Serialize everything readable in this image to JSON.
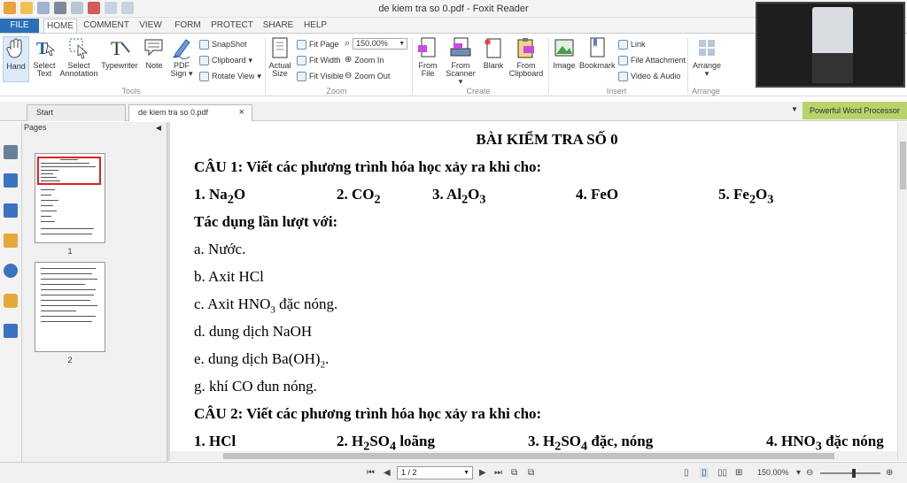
{
  "window": {
    "title": "de kiem tra so 0.pdf - Foxit Reader"
  },
  "menu": {
    "tabs": [
      "FILE",
      "HOME",
      "COMMENT",
      "VIEW",
      "FORM",
      "PROTECT",
      "SHARE",
      "HELP"
    ]
  },
  "ribbon": {
    "tools": {
      "group_label": "Tools",
      "hand": "Hand",
      "select_text": [
        "Select",
        "Text"
      ],
      "select_annotation": [
        "Select",
        "Annotation"
      ],
      "typewriter": "Typewriter",
      "note": "Note",
      "pdf_sign": [
        "PDF",
        "Sign"
      ]
    },
    "clipboard": {
      "snapshot": "SnapShot",
      "clipboard": "Clipboard",
      "reflow": "Rotate View"
    },
    "zoom": {
      "group_label": "Zoom",
      "actual_size": [
        "Actual",
        "Size"
      ],
      "fit_page": "Fit Page",
      "fit_width": "Fit Width",
      "fit_visible": "Fit Visible",
      "zoom_value": "150.00%",
      "zoom_in": "Zoom In",
      "zoom_out": "Zoom Out"
    },
    "create": {
      "group_label": "Create",
      "from_file": [
        "From",
        "File"
      ],
      "from_scanner": [
        "From",
        "Scanner"
      ],
      "blank": "Blank",
      "from_clipboard": [
        "From",
        "Clipboard"
      ]
    },
    "insert": {
      "group_label": "Insert",
      "image": "Image",
      "bookmark": "Bookmark",
      "link": "Link",
      "file_attachment": "File Attachment",
      "video_audio": "Video & Audio"
    },
    "arrange": {
      "group_label": "Arrange",
      "arrange": "Arrange"
    }
  },
  "doc_tabs": {
    "start": "Start",
    "active": "de kiem tra so 0.pdf",
    "close": "×",
    "promo": "Powerful Word Processor"
  },
  "pages_panel": {
    "title": "Pages",
    "page_numbers": [
      "1",
      "2"
    ]
  },
  "document": {
    "heading": "BÀI KIỂM TRA SỐ 0",
    "q1": "CÂU 1: Viết các phương trình hóa học xảy ra khi cho:",
    "q1_items": [
      {
        "num": "1. Na",
        "sub": "2",
        "rest": "O"
      },
      {
        "num": "2. CO",
        "sub": "2",
        "rest": ""
      },
      {
        "num": "3. Al",
        "sub": "2",
        "rest": "O",
        "sub2": "3"
      },
      {
        "num": "4. FeO",
        "sub": "",
        "rest": ""
      },
      {
        "num": "5. Fe",
        "sub": "2",
        "rest": "O",
        "sub2": "3"
      }
    ],
    "react_with": "Tác dụng lần lượt với:",
    "a": "a. Nước.",
    "b": "b. Axit HCl",
    "c_pre": "c. Axit HNO",
    "c_sub": "3",
    "c_post": " đặc nóng.",
    "d": "d. dung dịch NaOH",
    "e_pre": "e. dung dịch Ba(OH)",
    "e_sub": "2",
    "e_post": ".",
    "g": "g. khí CO đun nóng.",
    "q2": "CÂU 2: Viết các phương trình hóa học xảy ra khi cho:",
    "q2_items": [
      {
        "pre": "1. HCl",
        "sub": "",
        "post": ""
      },
      {
        "pre": "2. H",
        "sub": "2",
        "mid": "SO",
        "sub2": "4",
        "post": " loãng"
      },
      {
        "pre": "3. H",
        "sub": "2",
        "mid": "SO",
        "sub2": "4",
        "post": " đặc, nóng"
      },
      {
        "pre": "4. HNO",
        "sub": "3",
        "post": " đặc nóng"
      }
    ]
  },
  "statusbar": {
    "page": "1 / 2",
    "zoom": "150.00%"
  }
}
